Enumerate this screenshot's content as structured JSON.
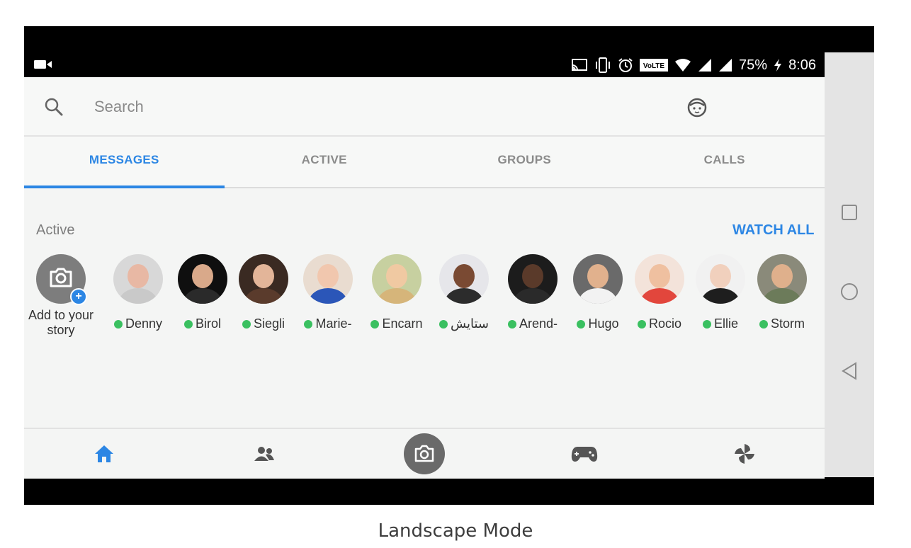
{
  "status_bar": {
    "battery": "75%",
    "time": "8:06",
    "lte_badge": "VoLTE",
    "icons": [
      "video-camera-icon",
      "cast-icon",
      "vibrate-icon",
      "alarm-icon",
      "volte-icon",
      "wifi-icon",
      "signal-icon",
      "signal-icon",
      "charging-icon"
    ]
  },
  "search": {
    "placeholder": "Search"
  },
  "tabs": [
    {
      "label": "MESSAGES",
      "active": true
    },
    {
      "label": "ACTIVE",
      "active": false
    },
    {
      "label": "GROUPS",
      "active": false
    },
    {
      "label": "CALLS",
      "active": false
    }
  ],
  "active_section": {
    "title": "Active",
    "watch_all": "WATCH ALL"
  },
  "story": {
    "label": "Add to your story"
  },
  "people": [
    {
      "name": "Denny",
      "skin": "#e8b8a4",
      "shirt": "#c9c9c9",
      "bg": "#d8d8d8"
    },
    {
      "name": "Birol",
      "skin": "#d9a98a",
      "shirt": "#2a2a2a",
      "bg": "#0f0f0f"
    },
    {
      "name": "Siegli",
      "skin": "#e3b599",
      "shirt": "#5a3b2c",
      "bg": "#3a2a22"
    },
    {
      "name": "Marie-",
      "skin": "#f1c7ae",
      "shirt": "#2b56b8",
      "bg": "#e9dcd0"
    },
    {
      "name": "Encarn",
      "skin": "#f0c9a2",
      "shirt": "#d6b57a",
      "bg": "#c7d0a0"
    },
    {
      "name": "ستايش",
      "skin": "#7a4a33",
      "shirt": "#2c2c2c",
      "bg": "#e6e6ea"
    },
    {
      "name": "Arend-",
      "skin": "#5a3a2a",
      "shirt": "#2a2a2a",
      "bg": "#1c1c1c"
    },
    {
      "name": "Hugo",
      "skin": "#e1b18d",
      "shirt": "#f2f2f2",
      "bg": "#6a6a6a"
    },
    {
      "name": "Rocio",
      "skin": "#efc0a0",
      "shirt": "#e2463c",
      "bg": "#f3e3da"
    },
    {
      "name": "Ellie",
      "skin": "#f1d0bd",
      "shirt": "#1e1e1e",
      "bg": "#f1f1f1"
    },
    {
      "name": "Storm",
      "skin": "#dfb08c",
      "shirt": "#6c7b5a",
      "bg": "#8a8a7a"
    }
  ],
  "bottom_nav": [
    {
      "icon": "home-icon",
      "active": true
    },
    {
      "icon": "people-icon",
      "active": false
    },
    {
      "icon": "camera-icon",
      "active": false
    },
    {
      "icon": "game-controller-icon",
      "active": false
    },
    {
      "icon": "pinwheel-icon",
      "active": false
    }
  ],
  "system_nav": [
    "recents-square-icon",
    "home-circle-icon",
    "back-triangle-icon"
  ],
  "colors": {
    "accent": "#2c86e4",
    "online": "#3ac060"
  },
  "caption": "Landscape Mode"
}
